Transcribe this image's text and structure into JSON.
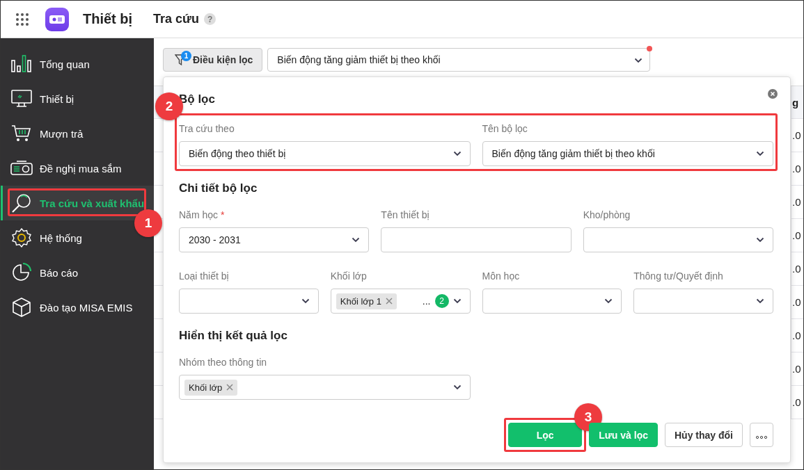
{
  "app": {
    "title": "Thiết bị"
  },
  "page": {
    "title": "Tra cứu",
    "help": "?"
  },
  "sidebar": {
    "items": [
      {
        "label": "Tổng quan",
        "kind": "chart",
        "selected": false
      },
      {
        "label": "Thiết bị",
        "kind": "monitor",
        "selected": false
      },
      {
        "label": "Mượn trả",
        "kind": "cart",
        "selected": false
      },
      {
        "label": "Đề nghị mua sắm",
        "kind": "projector",
        "selected": false
      },
      {
        "label": "Tra cứu và xuất khẩu",
        "kind": "search",
        "selected": true,
        "annotation": "1"
      },
      {
        "label": "Hệ thống",
        "kind": "gear",
        "selected": false
      },
      {
        "label": "Báo cáo",
        "kind": "pie",
        "selected": false
      },
      {
        "label": "Đào tạo MISA EMIS",
        "kind": "cube",
        "selected": false
      }
    ]
  },
  "toolbar": {
    "filter_button": {
      "label": "Điều kiện lọc",
      "badge": "1"
    },
    "saved_filter": {
      "value": "Biến động tăng giảm thiết bị theo khối",
      "modified": true
    }
  },
  "background_table": {
    "column_header": "g",
    "cells": [
      ".0",
      ".0",
      ".0",
      ".0",
      ".0",
      ".0",
      ".0",
      ".0",
      ".0"
    ]
  },
  "filter_panel": {
    "title": "Bộ lọc",
    "sections": [
      {
        "rows": [
          {
            "annotation": "2",
            "fields": [
              {
                "label": "Tra cứu theo",
                "kind": "select",
                "value": "Biến động theo thiết bị"
              },
              {
                "label": "Tên bộ lọc",
                "kind": "select",
                "value": "Biến động tăng giảm thiết bị theo khối"
              }
            ]
          }
        ]
      },
      {
        "heading": "Chi tiết bộ lọc",
        "rows": [
          {
            "fields": [
              {
                "label": "Năm học",
                "kind": "select",
                "value": "2030 - 2031",
                "required_marker": "*"
              },
              {
                "label": "Tên thiết bị",
                "kind": "text"
              },
              {
                "label": "Kho/phòng",
                "kind": "select"
              }
            ]
          },
          {
            "fields": [
              {
                "label": "Loại thiết bị",
                "kind": "select"
              },
              {
                "label": "Khối lớp",
                "kind": "tags",
                "tags": [
                  "Khối lớp 1"
                ],
                "more": "...",
                "more_count": "2"
              },
              {
                "label": "Môn học",
                "kind": "select"
              },
              {
                "label": "Thông tư/Quyết định",
                "kind": "select"
              }
            ]
          }
        ]
      },
      {
        "heading": "Hiển thị kết quả lọc",
        "rows": [
          {
            "fields": [
              {
                "label": "Nhóm theo thông tin",
                "kind": "tags",
                "tags": [
                  "Khối lớp"
                ]
              }
            ]
          }
        ]
      }
    ],
    "buttons": [
      {
        "label": "Lọc",
        "kind": "primary",
        "annotation": "3"
      },
      {
        "label": "Lưu và lọc",
        "kind": "primary"
      },
      {
        "label": "Hủy thay đổi",
        "kind": "secondary"
      },
      {
        "kind": "more"
      }
    ]
  }
}
